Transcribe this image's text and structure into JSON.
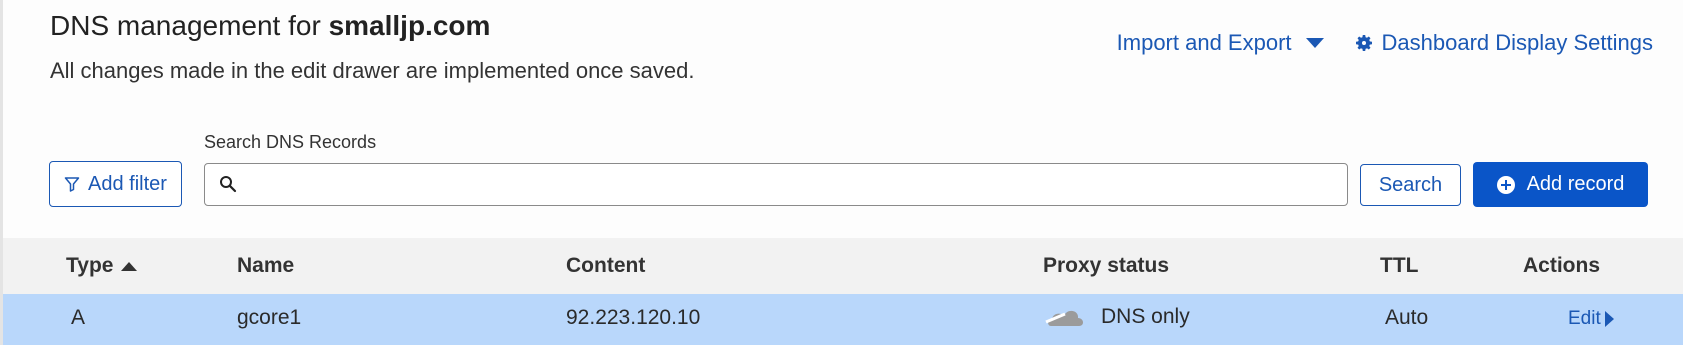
{
  "header": {
    "title_prefix": "DNS management for ",
    "domain": "smalljp.com",
    "subtitle": "All changes made in the edit drawer are implemented once saved.",
    "import_export_label": "Import and Export",
    "dashboard_settings_label": "Dashboard Display Settings"
  },
  "toolbar": {
    "add_filter_label": "Add filter",
    "search_label": "Search DNS Records",
    "search_value": "",
    "search_button_label": "Search",
    "add_record_label": "Add record"
  },
  "table": {
    "columns": [
      "Type",
      "Name",
      "Content",
      "Proxy status",
      "TTL",
      "Actions"
    ],
    "rows": [
      {
        "type": "A",
        "name": "gcore1",
        "content": "92.223.120.10",
        "proxy_status": "DNS only",
        "ttl": "Auto",
        "action": "Edit"
      }
    ]
  },
  "colors": {
    "accent": "#1b58b4",
    "primary_button": "#0a55c8",
    "selected_row": "#b9d7fb",
    "header_row": "#f2f2f2"
  },
  "icons": [
    "caret-down-icon",
    "gear-icon",
    "filter-icon",
    "search-icon",
    "plus-circle-icon",
    "sort-up-icon",
    "cloud-icon",
    "caret-right-icon"
  ]
}
